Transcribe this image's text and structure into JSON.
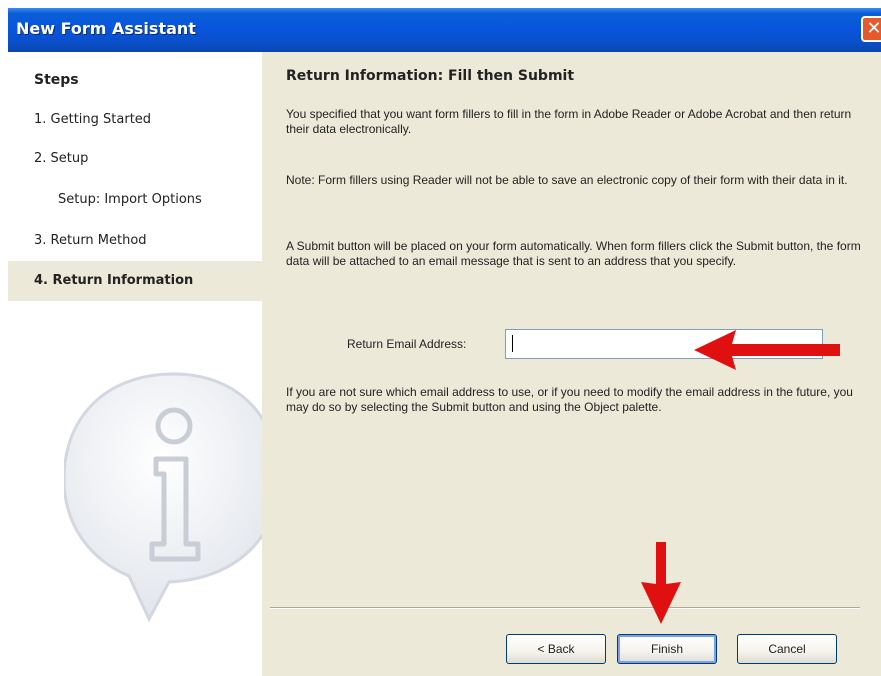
{
  "window": {
    "title": "New Form Assistant",
    "close_glyph": "✕"
  },
  "sidebar": {
    "heading": "Steps",
    "items": [
      {
        "label": "1. Getting Started"
      },
      {
        "label": "2. Setup"
      },
      {
        "label": "Setup: Import Options"
      },
      {
        "label": "3. Return Method"
      },
      {
        "label": "4. Return Information",
        "active": true
      }
    ],
    "watermark_icon": "info-speech-bubble-icon"
  },
  "main": {
    "heading": "Return Information: Fill then Submit",
    "paragraphs": [
      "You specified that you want form fillers to fill in the form in Adobe Reader or Adobe Acrobat and then return their data electronically.",
      "Note: Form fillers using Reader will not be able to save an electronic copy of their form with their data in it.",
      "A Submit button will be placed on your form automatically.  When form fillers click the Submit button, the form data will be attached to an email message that is sent to an address that you specify.",
      "If you are not sure which email address to use, or if you need to modify the email address in the future, you may do so  by selecting the Submit button and using the Object palette."
    ],
    "email": {
      "label": "Return Email Address:",
      "value": ""
    }
  },
  "buttons": {
    "back": "< Back",
    "finish": "Finish",
    "cancel": "Cancel"
  },
  "colors": {
    "titlebar": "#0855dd",
    "dialog_bg": "#ece9d8",
    "annotation_arrow": "#e01010",
    "close_button": "#e45a2c"
  }
}
